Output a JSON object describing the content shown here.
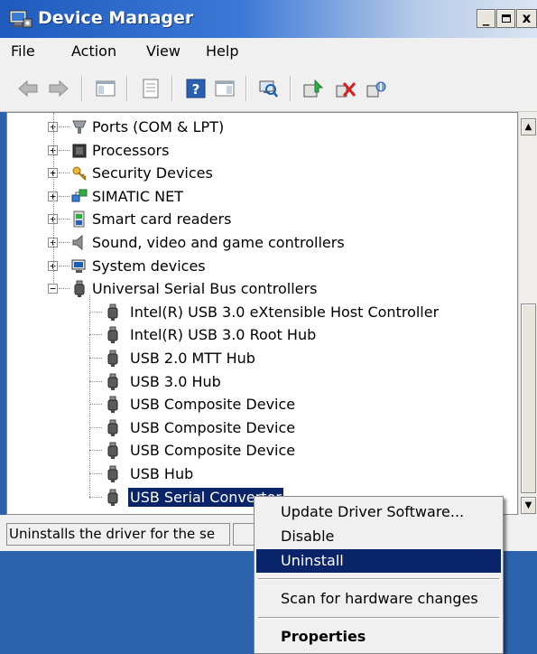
{
  "window": {
    "title": "Device Manager",
    "minimize_glyph": "_",
    "maximize_glyph": "□",
    "close_glyph": "x"
  },
  "menu": [
    "File",
    "Action",
    "View",
    "Help"
  ],
  "toolbar": {
    "icons": [
      "back-arrow-icon",
      "forward-arrow-icon",
      "show-hide-console-tree-icon",
      "properties-icon",
      "help-icon",
      "action-pane-icon",
      "scan-hardware-icon",
      "update-driver-icon",
      "uninstall-icon",
      "disable-icon"
    ]
  },
  "tree": {
    "categories": [
      {
        "label": "Ports (COM & LPT)",
        "icon": "port-icon",
        "expander": "+"
      },
      {
        "label": "Processors",
        "icon": "processor-icon",
        "expander": "+"
      },
      {
        "label": "Security Devices",
        "icon": "key-icon",
        "expander": "+"
      },
      {
        "label": "SIMATIC NET",
        "icon": "network-icon",
        "expander": "+"
      },
      {
        "label": "Smart card readers",
        "icon": "smart-card-icon",
        "expander": "+"
      },
      {
        "label": "Sound, video and game controllers",
        "icon": "speaker-icon",
        "expander": "+"
      },
      {
        "label": "System devices",
        "icon": "computer-icon",
        "expander": "+"
      },
      {
        "label": "Universal Serial Bus controllers",
        "icon": "usb-plug-icon",
        "expander": "−"
      }
    ],
    "usb_children": [
      "Intel(R) USB 3.0 eXtensible Host Controller",
      "Intel(R) USB 3.0 Root Hub",
      "USB 2.0 MTT Hub",
      "USB 3.0 Hub",
      "USB Composite Device",
      "USB Composite Device",
      "USB Composite Device",
      "USB Hub",
      "USB Serial Converter"
    ],
    "selected": "USB Serial Converter"
  },
  "scrollbar": {
    "up_glyph": "▲",
    "down_glyph": "▼"
  },
  "status": {
    "text": "Uninstalls the driver for the se"
  },
  "context_menu": {
    "items": [
      {
        "label": "Update Driver Software...",
        "bold": false,
        "highlighted": false
      },
      {
        "label": "Disable",
        "bold": false,
        "highlighted": false
      },
      {
        "label": "Uninstall",
        "bold": false,
        "highlighted": true
      },
      {
        "label": "Scan for hardware changes",
        "bold": false,
        "highlighted": false
      },
      {
        "label": "Properties",
        "bold": true,
        "highlighted": false
      }
    ]
  },
  "colors": {
    "selection": "#0a246a",
    "desktop": "#2d63ac",
    "titlebar": "#1f5bbd"
  }
}
